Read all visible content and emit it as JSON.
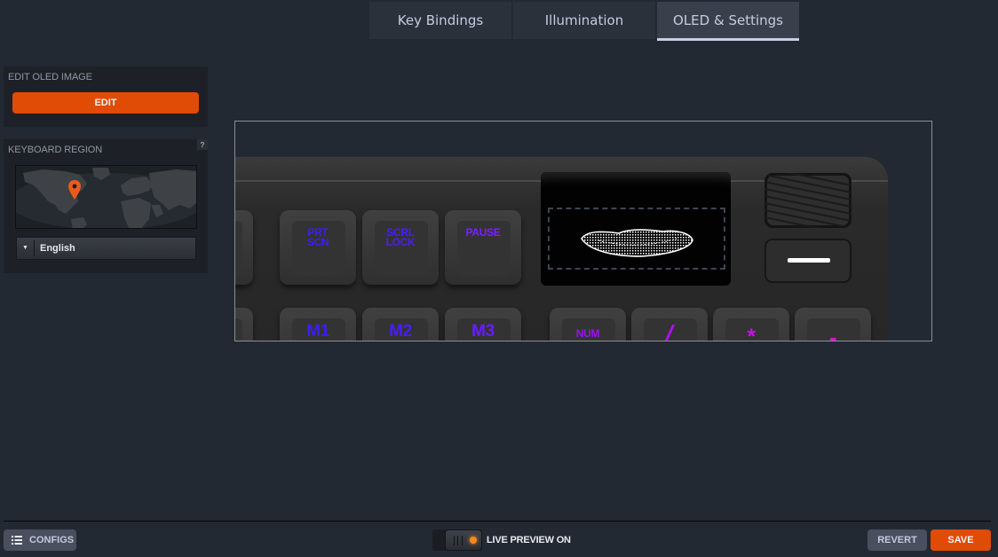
{
  "tabs": [
    {
      "label": "Key Bindings",
      "active": false
    },
    {
      "label": "Illumination",
      "active": false
    },
    {
      "label": "OLED & Settings",
      "active": true
    }
  ],
  "oled_panel": {
    "title": "EDIT OLED IMAGE",
    "edit_label": "EDIT"
  },
  "region_panel": {
    "title": "KEYBOARD REGION",
    "help_label": "?",
    "language": "English",
    "pin_location": "North America"
  },
  "preview": {
    "keys_row1": [
      {
        "label": "PRT\nSCN",
        "color": "#3a1cff"
      },
      {
        "label": "SCRL\nLOCK",
        "color": "#4a1cff"
      },
      {
        "label": "PAUSE",
        "color": "#7a20ff"
      }
    ],
    "keys_row2": [
      {
        "label": "M1",
        "color": "#3a1cff"
      },
      {
        "label": "M2",
        "color": "#4a1cff"
      },
      {
        "label": "M3",
        "color": "#6a1cff"
      },
      {
        "label": "NUM",
        "color": "#9a10f5"
      },
      {
        "label": "/",
        "color": "#b010f0"
      },
      {
        "label": "*",
        "color": "#c810e8"
      },
      {
        "label": "-",
        "color": "#d810e0"
      }
    ]
  },
  "footer": {
    "configs_label": "CONFIGS",
    "live_preview_label": "LIVE PREVIEW ON",
    "live_preview_on": true,
    "revert_label": "REVERT",
    "save_label": "SAVE"
  },
  "colors": {
    "accent": "#e04b05",
    "background": "#232932",
    "panel": "#1d2127",
    "led": "#f7871e"
  }
}
